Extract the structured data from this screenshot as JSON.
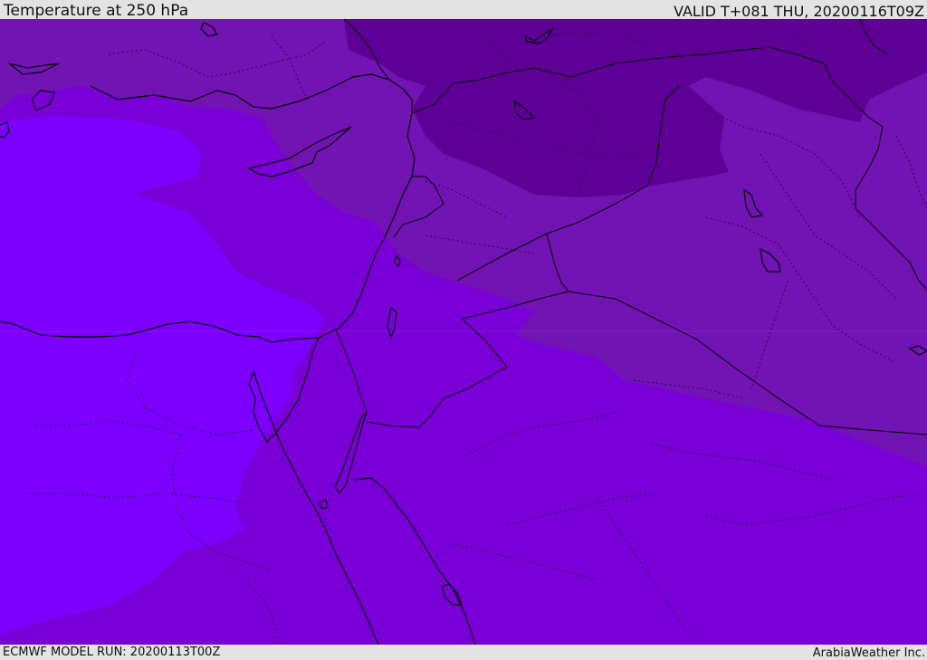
{
  "header": {
    "title": "Temperature at 250 hPa",
    "valid_time": "VALID T+081 THU, 20200116T09Z"
  },
  "footer": {
    "model_run": "ECMWF MODEL RUN: 20200113T00Z",
    "credit": "ArabiaWeather Inc."
  },
  "map": {
    "field": "temperature",
    "level": "250 hPa",
    "shading_colors": {
      "coldest": "#5e0096",
      "cold": "#7213b4",
      "mid": "#7a00d8",
      "warm": "#7d00ff"
    },
    "line_colors": {
      "coastlines_and_borders": "#000000",
      "provinces": "#2a0050"
    }
  }
}
